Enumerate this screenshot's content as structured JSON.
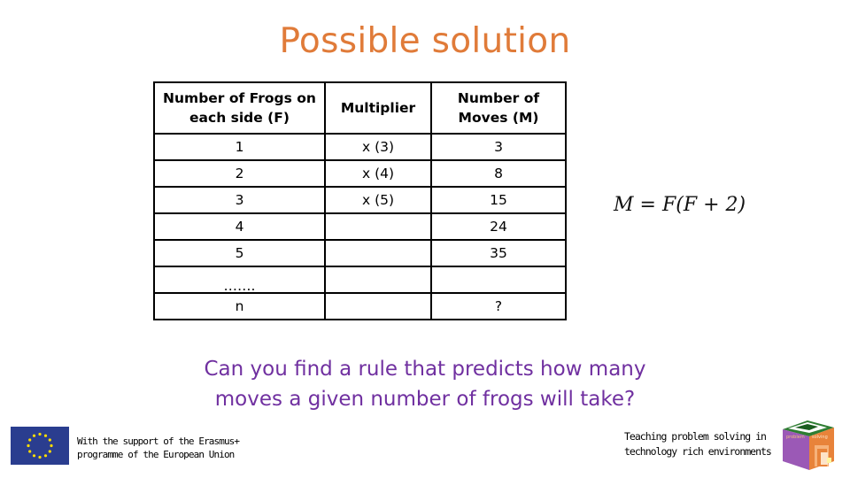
{
  "title": "Possible solution",
  "table": {
    "headers": [
      "Number of Frogs on each side (F)",
      "Multiplier",
      "Number of Moves (M)"
    ],
    "rows": [
      [
        "1",
        "x (3)",
        "3"
      ],
      [
        "2",
        "x (4)",
        "8"
      ],
      [
        "3",
        "x (5)",
        "15"
      ],
      [
        "4",
        "",
        "24"
      ],
      [
        "5",
        "",
        "35"
      ],
      [
        "…….",
        "",
        ""
      ],
      [
        "n",
        "",
        "?"
      ]
    ]
  },
  "formula": {
    "lhs": "M",
    "equals": "=",
    "rhs": "F(F + 2)"
  },
  "question": {
    "line1": "Can you find a rule that predicts how many",
    "line2": "moves a given number of frogs will take?"
  },
  "footer": {
    "eu_line1": "With the support of the Erasmus+",
    "eu_line2": "programme of the European Union",
    "project_line1": "Teaching problem solving in",
    "project_line2": "technology rich environments",
    "logo_label_left": "problem",
    "logo_label_right": "solving"
  },
  "colors": {
    "title": "#e07b39",
    "question": "#7030a0",
    "eu_blue": "#2a3d8f",
    "eu_star": "#ffdd00"
  }
}
